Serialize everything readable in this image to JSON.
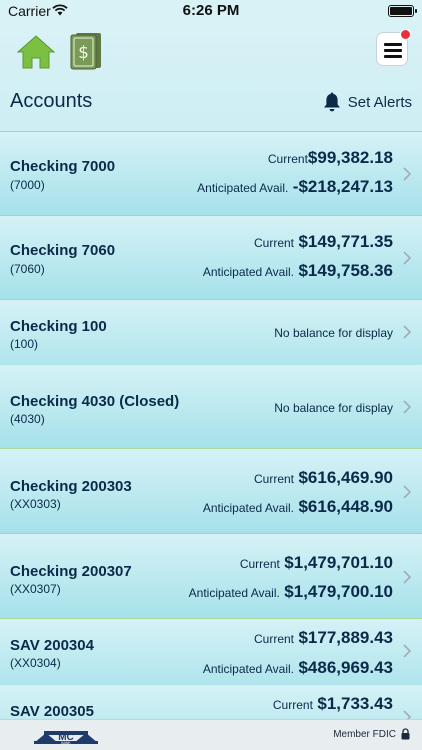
{
  "status_bar": {
    "carrier": "Carrier",
    "time": "6:26 PM"
  },
  "header": {
    "title": "Accounts",
    "set_alerts_label": "Set Alerts"
  },
  "icons": {
    "home": "home-icon",
    "dollar": "dollar-bill-icon",
    "menu": "hamburger-menu-icon",
    "bell": "bell-icon",
    "chevron": "chevron-right-icon",
    "lock": "lock-icon"
  },
  "colors": {
    "brand_navy": "#0b2a4a",
    "row_gradient_top": "#d5f2f6",
    "row_gradient_bottom": "#a6e1ea",
    "notification_red": "#e8303a",
    "home_green": "#7bc043"
  },
  "accounts": [
    {
      "name": "Checking 7000",
      "number": "(7000)",
      "current_label": "Current",
      "current": "$99,382.18",
      "anticipated_label": "Anticipated Avail.",
      "anticipated": "-$218,247.13"
    },
    {
      "name": "Checking 7060",
      "number": "(7060)",
      "current_label": "Current",
      "current": "$149,771.35",
      "anticipated_label": "Anticipated Avail.",
      "anticipated": "$149,758.36"
    },
    {
      "name": "Checking 100",
      "number": "(100)",
      "no_balance": "No balance for display"
    },
    {
      "name": "Checking 4030 (Closed)",
      "number": "(4030)",
      "no_balance": "No balance for display"
    },
    {
      "name": "Checking 200303",
      "number": "(XX0303)",
      "current_label": "Current",
      "current": "$616,469.90",
      "anticipated_label": "Anticipated Avail.",
      "anticipated": "$616,448.90"
    },
    {
      "name": "Checking 200307",
      "number": "(XX0307)",
      "current_label": "Current",
      "current": "$1,479,701.10",
      "anticipated_label": "Anticipated Avail.",
      "anticipated": "$1,479,700.10"
    },
    {
      "name": "SAV 200304",
      "number": "(XX0304)",
      "current_label": "Current",
      "current": "$177,889.43",
      "anticipated_label": "Anticipated Avail.",
      "anticipated": "$486,969.43"
    },
    {
      "name": "SAV 200305",
      "current_label": "Current",
      "current": "$1,733.43"
    }
  ],
  "footer": {
    "logo_text": "MC",
    "logo_subtext": "BANK",
    "member_fdic": "Member FDIC"
  }
}
